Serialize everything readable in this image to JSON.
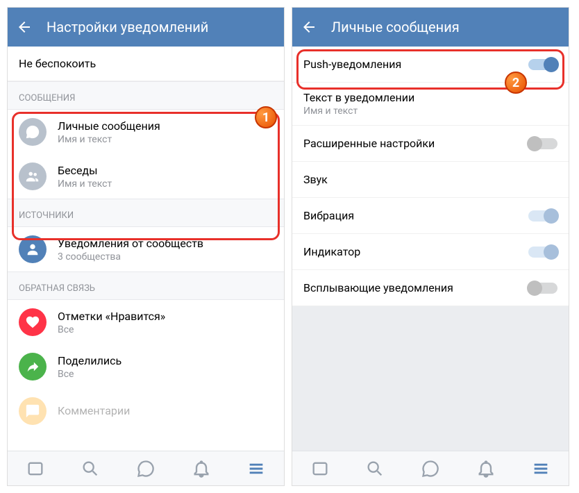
{
  "left": {
    "header_title": "Настройки уведомлений",
    "dnd": "Не беспокоить",
    "sections": {
      "messages": {
        "header": "СООБЩЕНИЯ",
        "items": [
          {
            "title": "Личные сообщения",
            "sub": "Имя и текст"
          },
          {
            "title": "Беседы",
            "sub": "Имя и текст"
          }
        ]
      },
      "sources": {
        "header": "ИСТОЧНИКИ",
        "items": [
          {
            "title": "Уведомления от сообществ",
            "sub": "3 сообщества"
          }
        ]
      },
      "feedback": {
        "header": "ОБРАТНАЯ СВЯЗЬ",
        "items": [
          {
            "title": "Отметки «Нравится»",
            "sub": "Все"
          },
          {
            "title": "Поделились",
            "sub": "Все"
          },
          {
            "title": "Комментарии",
            "sub": ""
          }
        ]
      }
    }
  },
  "right": {
    "header_title": "Личные сообщения",
    "push": "Push-уведомления",
    "text_block": {
      "title": "Текст в уведомлении",
      "sub": "Имя и текст"
    },
    "settings": [
      "Расширенные настройки",
      "Звук",
      "Вибрация",
      "Индикатор",
      "Всплывающие уведомления"
    ]
  },
  "badges": {
    "one": "1",
    "two": "2"
  }
}
